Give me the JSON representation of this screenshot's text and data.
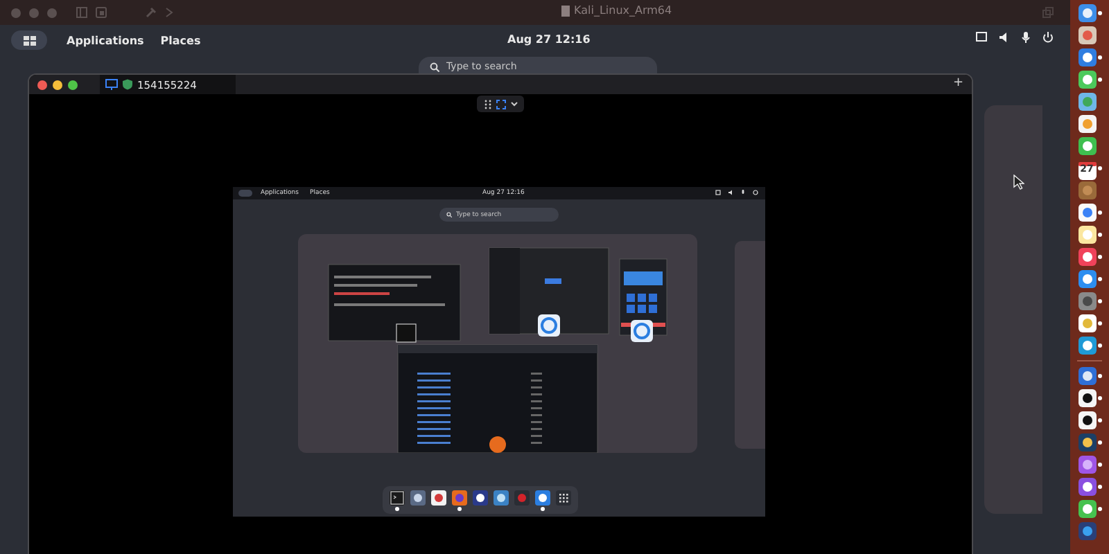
{
  "window": {
    "title": "Kali_Linux_Arm64"
  },
  "top_bar": {
    "menus": [
      "Applications",
      "Places"
    ],
    "clock": "Aug 27  12:16"
  },
  "search": {
    "placeholder": "Type to search"
  },
  "remote_window": {
    "title": "154155224",
    "new_tab": "+",
    "screen": {
      "top_bar": {
        "menus": [
          "Applications",
          "Places"
        ],
        "clock": "Aug 27  12:16"
      },
      "search": {
        "placeholder": "Type to search"
      },
      "dock": [
        {
          "kind": "terminal",
          "running": true
        },
        {
          "kind": "files",
          "running": false
        },
        {
          "kind": "editor",
          "running": false
        },
        {
          "kind": "firefox",
          "running": true
        },
        {
          "kind": "letter",
          "running": false
        },
        {
          "kind": "globe",
          "running": false
        },
        {
          "kind": "cherry",
          "running": false
        },
        {
          "kind": "remote",
          "running": true
        },
        {
          "kind": "grid",
          "running": false
        }
      ]
    }
  },
  "dock": [
    {
      "kind": "finder",
      "running": true
    },
    {
      "kind": "launchpad",
      "running": false
    },
    {
      "kind": "safari",
      "running": true
    },
    {
      "kind": "messages",
      "running": true
    },
    {
      "kind": "maps",
      "running": false
    },
    {
      "kind": "photos",
      "running": false
    },
    {
      "kind": "facetime",
      "running": false
    },
    {
      "kind": "calendar",
      "running": true,
      "label": "27"
    },
    {
      "kind": "notebook",
      "running": false
    },
    {
      "kind": "reminders",
      "running": true
    },
    {
      "kind": "notes",
      "running": true
    },
    {
      "kind": "music",
      "running": true
    },
    {
      "kind": "appstore",
      "running": true
    },
    {
      "kind": "settings",
      "running": true
    },
    {
      "kind": "chrome",
      "running": true
    },
    {
      "kind": "edge",
      "running": true
    },
    {
      "kind": "separator"
    },
    {
      "kind": "xcode",
      "running": true
    },
    {
      "kind": "penguin",
      "running": true
    },
    {
      "kind": "penguin",
      "running": true
    },
    {
      "kind": "monitor",
      "running": true
    },
    {
      "kind": "purple",
      "running": true
    },
    {
      "kind": "github",
      "running": true
    },
    {
      "kind": "wechat",
      "running": true
    },
    {
      "kind": "player",
      "running": false
    }
  ]
}
